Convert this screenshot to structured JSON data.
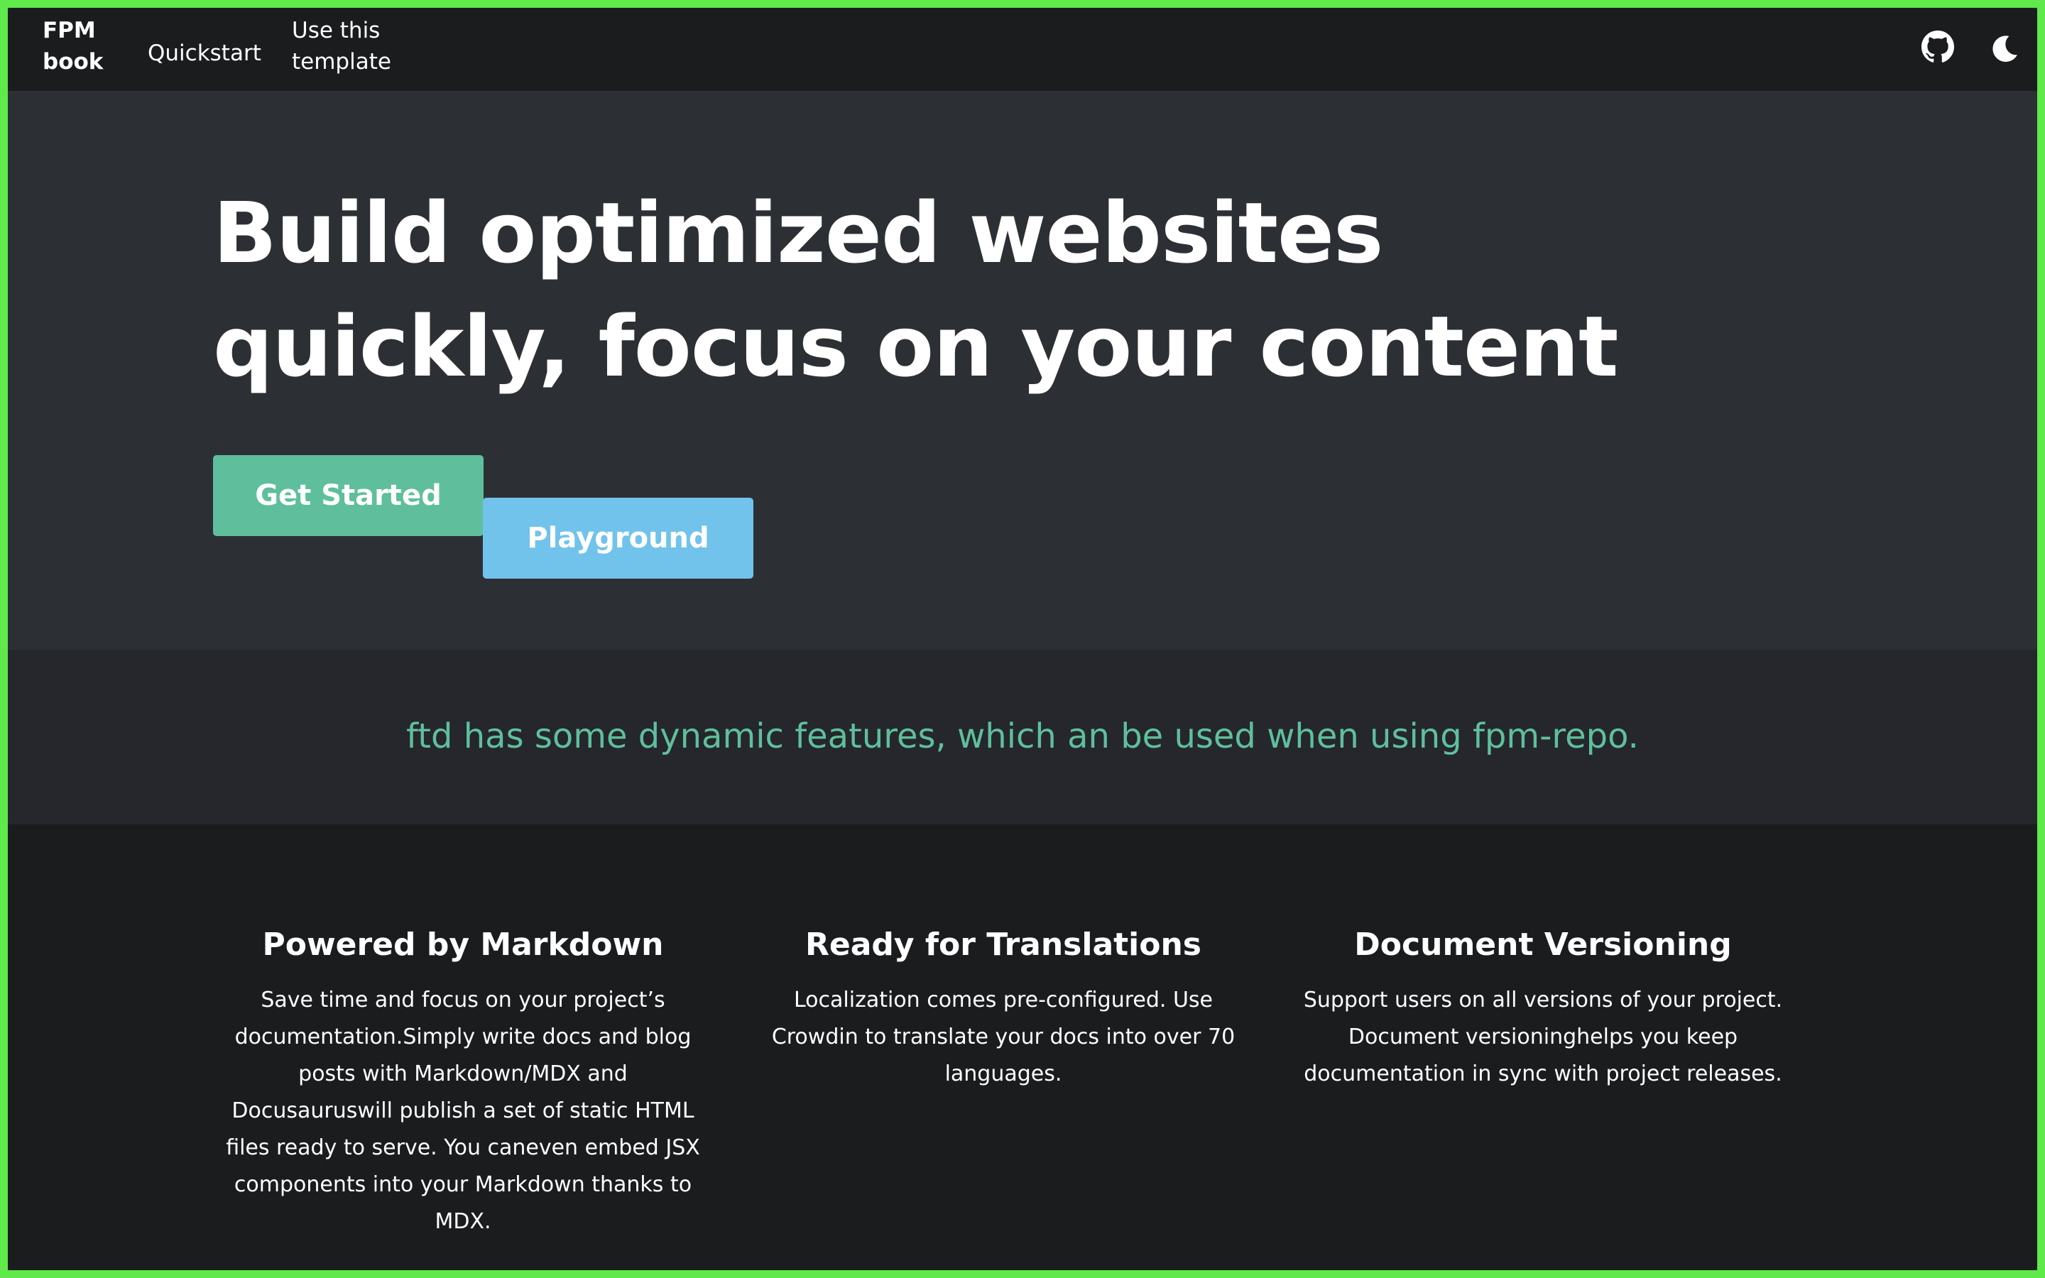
{
  "navbar": {
    "brand": "FPM book",
    "links": [
      "Quickstart",
      "Use this template"
    ],
    "icons": [
      "github-icon",
      "moon-icon"
    ]
  },
  "hero": {
    "title": "Build optimized websites quickly, focus on your content",
    "primary_button": "Get Started",
    "secondary_button": "Playground"
  },
  "banner": {
    "text": "ftd has some dynamic features, which an be used when using fpm-repo."
  },
  "features": [
    {
      "title": "Powered by Markdown",
      "description": "Save time and focus on your project’s documentation.Simply write docs and blog posts with Markdown/MDX and Docusauruswill publish a set of static HTML files ready to serve. You caneven embed JSX components into your Markdown thanks to MDX."
    },
    {
      "title": "Ready for Translations",
      "description": "Localization comes pre-configured. Use Crowdin to translate your docs into over 70 languages."
    },
    {
      "title": "Document Versioning",
      "description": "Support users on all versions of your project. Document versioninghelps you keep documentation in sync with project releases."
    }
  ],
  "colors": {
    "frame_border": "#5fe94a",
    "navbar_bg": "#1b1c1e",
    "hero_bg": "#2c3035",
    "banner_bg": "#25272c",
    "accent_green": "#5fbf9c",
    "accent_blue": "#71c3eb"
  }
}
